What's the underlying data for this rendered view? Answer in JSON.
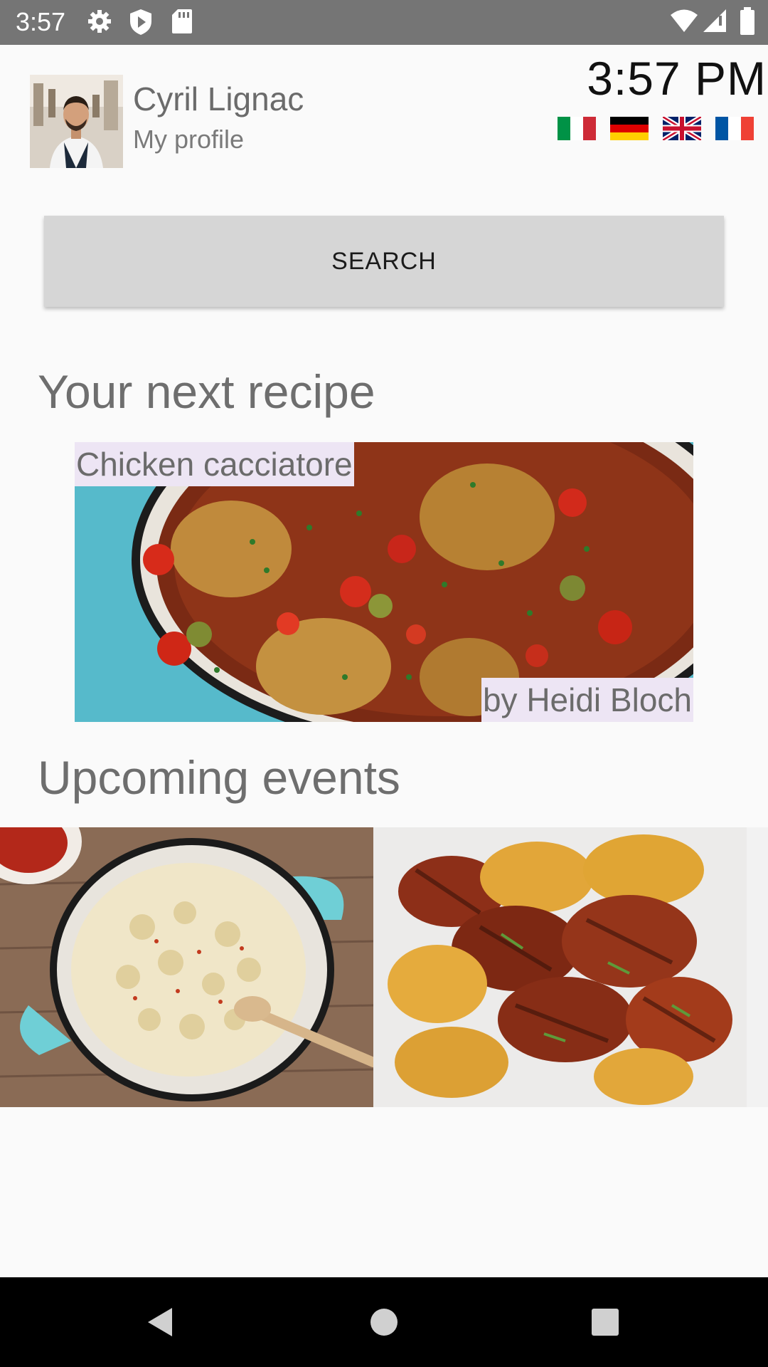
{
  "status_bar": {
    "time": "3:57",
    "left_icons": [
      "gear-icon",
      "shield-play-icon",
      "sd-card-icon"
    ],
    "right_icons": [
      "wifi-icon",
      "signal-icon",
      "battery-icon"
    ]
  },
  "profile": {
    "name": "Cyril Lignac",
    "link_label": "My profile"
  },
  "clock": "3:57 PM",
  "languages": [
    "it-flag",
    "de-flag",
    "uk-flag",
    "fr-flag"
  ],
  "search": {
    "label": "SEARCH"
  },
  "next_recipe": {
    "heading": "Your next recipe",
    "title": "Chicken cacciatore",
    "author": "by Heidi Bloch"
  },
  "events": {
    "heading": "Upcoming events",
    "items": [
      "mac-and-cheese-image",
      "grilled-wings-image"
    ]
  },
  "colors": {
    "status_bar": "#757575",
    "label_bg": "#ede5f4",
    "button_bg": "#d6d6d6"
  }
}
